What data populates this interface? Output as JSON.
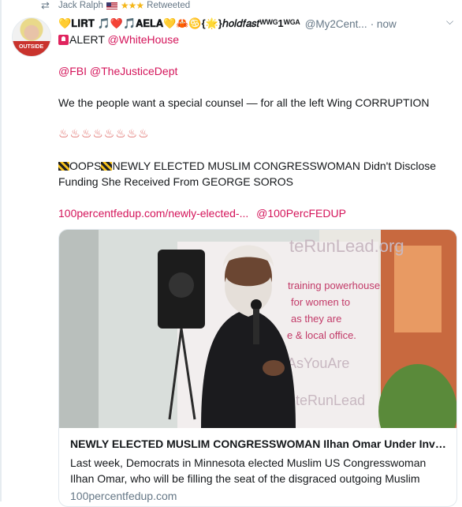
{
  "retweet": {
    "user": "Jack Ralph",
    "label": "Retweeted"
  },
  "tweet": {
    "display_name": "💛𝐋𝐈𝐑𝐓 🎵❤️🎵𝐀𝐄𝐋𝐀💛🦀♋{🌟}ℎ𝑜𝑙𝑑𝑓𝑎𝑠𝑡ᵂᵂᴳ1ᵂᴳᴬ",
    "handle": "@My2Cent...",
    "time": "· now",
    "line1_rest": "ALERT",
    "mention_whitehouse": "@WhiteHouse",
    "mention_fbi": "@FBI",
    "mention_doj": "@TheJusticeDept",
    "body1": "We the people want a special counsel — for all the left Wing CORRUPTION",
    "hot_springs": "♨♨♨♨♨♨♨♨",
    "oops": "OOPS",
    "headline_line1": "NEWLY ELECTED MUSLIM CONGRESSWOMAN Didn't Disclose",
    "headline_line2": "Funding She Received From GEORGE SOROS",
    "link": "100percentfedup.com/newly-elected-...",
    "link_mention": "@100PercFEDUP"
  },
  "card": {
    "title": "NEWLY ELECTED MUSLIM CONGRESSWOMAN Ilhan Omar Under Investig...",
    "description": "Last week, Democrats in Minnesota elected Muslim US Congresswoman Ilhan Omar, who will be filling the seat of the disgraced outgoing Muslim congressm...",
    "domain": "100percentfedup.com",
    "banner_text": "teRunLead.org",
    "banner_lines": [
      "training powerhouse",
      "for women to",
      "as they are",
      "e & local office."
    ],
    "banner_hashtag": "AsYouAre",
    "banner_footer": "oteRunLead"
  },
  "colors": {
    "link": "#d4145a",
    "muted": "#657786"
  }
}
